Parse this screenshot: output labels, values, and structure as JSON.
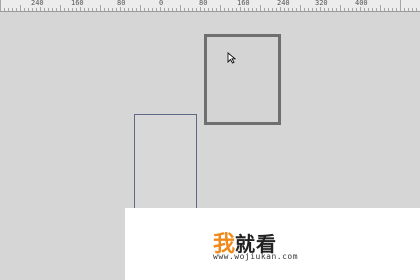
{
  "ruler": {
    "labels": [
      "240",
      "160",
      "80",
      "0",
      "80",
      "160",
      "240",
      "320",
      "400"
    ]
  },
  "watermark": {
    "char1": "我",
    "chars": "就看",
    "url": "www.wojiukan.com"
  },
  "icons": {
    "cursor": "mouse-pointer-icon"
  }
}
